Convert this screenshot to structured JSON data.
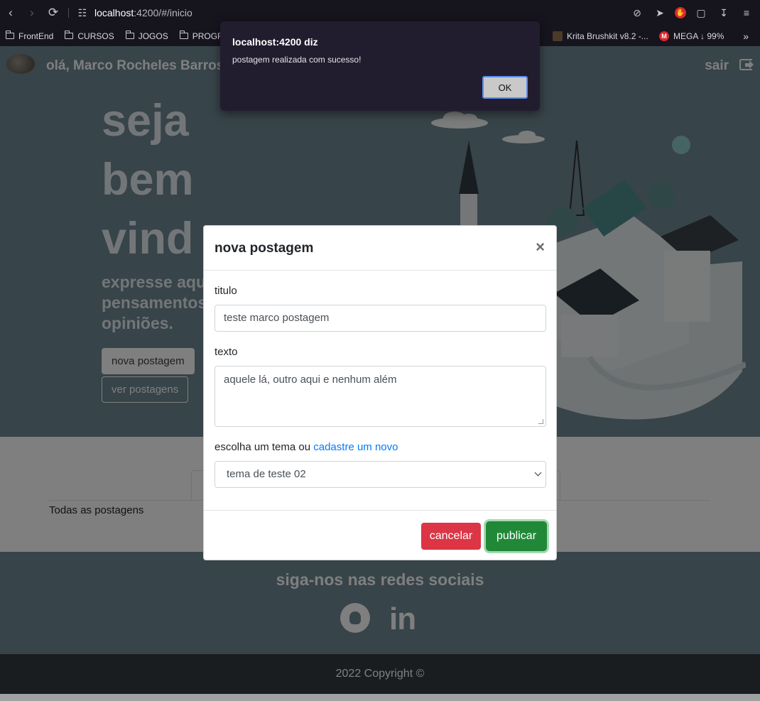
{
  "browser": {
    "url_host": "localhost",
    "url_rest": ":4200/#/inicio",
    "bookmarks": [
      {
        "label": "FrontEnd",
        "icon": "folder-icon"
      },
      {
        "label": "CURSOS",
        "icon": "folder-icon"
      },
      {
        "label": "JOGOS",
        "icon": "folder-icon"
      },
      {
        "label": "PROGRA",
        "icon": "folder-icon"
      },
      {
        "label": "Krita Brushkit v8.2 -...",
        "icon": "krita-icon"
      },
      {
        "label": "MEGA ↓ 99%",
        "icon": "mega-icon"
      }
    ],
    "more": "»"
  },
  "navbar": {
    "greeting": "olá, Marco Rocheles Barros",
    "logout": "sair"
  },
  "hero": {
    "title_1": "seja",
    "title_2": "bem",
    "title_3": "vind",
    "subtitle_1": "expresse aqu",
    "subtitle_2": "pensamentos",
    "subtitle_3": "opiniões.",
    "btn_new": "nova postagem",
    "btn_view": "ver postagens"
  },
  "tabs": {
    "all_posts": "Todas as postagens"
  },
  "footer": {
    "social_title": "siga-nos nas redes sociais",
    "copyright": "2022 Copyright ©"
  },
  "modal": {
    "title": "nova postagem",
    "close": "×",
    "label_title": "titulo",
    "value_title": "teste marco postagem",
    "label_text": "texto",
    "value_text": "aquele lá, outro aqui e nenhum além",
    "label_theme": "escolha um tema ou",
    "link_new_theme": "cadastre um novo",
    "selected_theme": "tema de teste 02",
    "btn_cancel": "cancelar",
    "btn_publish": "publicar",
    "colors": {
      "cancel": "#dc3545",
      "publish": "#218838"
    }
  },
  "alert": {
    "title": "localhost:4200 diz",
    "message": "postagem realizada com sucesso!",
    "ok": "OK"
  }
}
